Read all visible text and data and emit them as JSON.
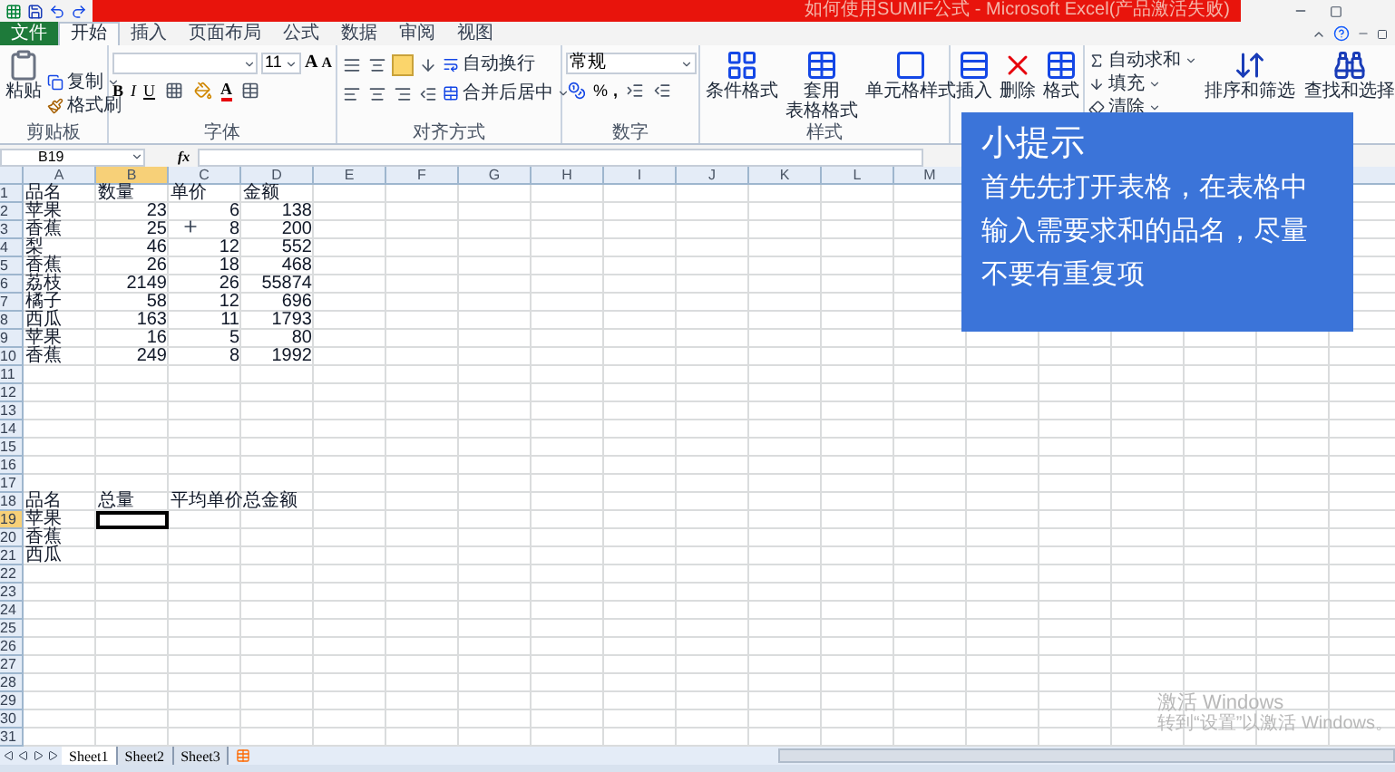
{
  "window": {
    "title": "如何使用SUMIF公式 - Microsoft Excel(产品激活失败)"
  },
  "ribbon_tabs": [
    {
      "label": "文件",
      "kind": "file",
      "selected": false
    },
    {
      "label": "开始",
      "kind": "tab",
      "selected": true
    },
    {
      "label": "插入",
      "kind": "tab",
      "selected": false
    },
    {
      "label": "页面布局",
      "kind": "tab",
      "selected": false
    },
    {
      "label": "公式",
      "kind": "tab",
      "selected": false
    },
    {
      "label": "数据",
      "kind": "tab",
      "selected": false
    },
    {
      "label": "审阅",
      "kind": "tab",
      "selected": false
    },
    {
      "label": "视图",
      "kind": "tab",
      "selected": false
    }
  ],
  "clipboard": {
    "label": "剪贴板",
    "paste": "粘贴",
    "copy": "复制",
    "format_painter": "格式刷"
  },
  "font": {
    "label": "字体",
    "size": "11",
    "grow": "A",
    "shrink": "A",
    "bold": "B",
    "italic": "I",
    "underline": "U",
    "font_color": "A"
  },
  "alignment": {
    "label": "对齐方式",
    "wrap": "自动换行",
    "merge": "合并后居中"
  },
  "number": {
    "label": "数字",
    "format": "常规",
    "percent": "%",
    "comma": ","
  },
  "styles": {
    "label": "样式",
    "items": [
      {
        "lines": [
          "条件格式"
        ]
      },
      {
        "lines": [
          "套用",
          "表格格式"
        ]
      },
      {
        "lines": [
          "单元格样式"
        ]
      }
    ]
  },
  "cells": {
    "items": [
      {
        "label": "插入"
      },
      {
        "label": "删除"
      },
      {
        "label": "格式"
      }
    ]
  },
  "editing": {
    "small": [
      {
        "label": "自动求和"
      },
      {
        "label": "填充"
      },
      {
        "label": "清除"
      }
    ],
    "large": [
      {
        "label": "排序和筛选"
      },
      {
        "label": "查找和选择"
      }
    ]
  },
  "formula_bar": {
    "name_box": "B19",
    "fx": "fx"
  },
  "sheet": {
    "columns": [
      {
        "letter": "A",
        "selected": false
      },
      {
        "letter": "B",
        "selected": true
      },
      {
        "letter": "C",
        "selected": false
      },
      {
        "letter": "D",
        "selected": false
      },
      {
        "letter": "E",
        "selected": false
      },
      {
        "letter": "F",
        "selected": false
      },
      {
        "letter": "G",
        "selected": false
      },
      {
        "letter": "H",
        "selected": false
      },
      {
        "letter": "I",
        "selected": false
      },
      {
        "letter": "J",
        "selected": false
      },
      {
        "letter": "K",
        "selected": false
      },
      {
        "letter": "L",
        "selected": false
      },
      {
        "letter": "M",
        "selected": false
      }
    ],
    "rows": [
      {
        "number": "1",
        "kind": "label",
        "selected": false,
        "cells": [
          "品名",
          "数量",
          "单价",
          "金额"
        ]
      },
      {
        "number": "2",
        "kind": "data",
        "selected": false,
        "cells": [
          "苹果",
          "23",
          "6",
          "138"
        ]
      },
      {
        "number": "3",
        "kind": "data",
        "selected": false,
        "cells": [
          "香蕉",
          "25",
          "8",
          "200"
        ]
      },
      {
        "number": "4",
        "kind": "data",
        "selected": false,
        "cells": [
          "梨",
          "46",
          "12",
          "552"
        ]
      },
      {
        "number": "5",
        "kind": "data",
        "selected": false,
        "cells": [
          "香蕉",
          "26",
          "18",
          "468"
        ]
      },
      {
        "number": "6",
        "kind": "data",
        "selected": false,
        "cells": [
          "荔枝",
          "2149",
          "26",
          "55874"
        ]
      },
      {
        "number": "7",
        "kind": "data",
        "selected": false,
        "cells": [
          "橘子",
          "58",
          "12",
          "696"
        ]
      },
      {
        "number": "8",
        "kind": "data",
        "selected": false,
        "cells": [
          "西瓜",
          "163",
          "11",
          "1793"
        ]
      },
      {
        "number": "9",
        "kind": "data",
        "selected": false,
        "cells": [
          "苹果",
          "16",
          "5",
          "80"
        ]
      },
      {
        "number": "10",
        "kind": "data",
        "selected": false,
        "cells": [
          "香蕉",
          "249",
          "8",
          "1992"
        ]
      },
      {
        "number": "11",
        "kind": "label",
        "selected": false,
        "cells": []
      },
      {
        "number": "12",
        "kind": "label",
        "selected": false,
        "cells": []
      },
      {
        "number": "13",
        "kind": "label",
        "selected": false,
        "cells": []
      },
      {
        "number": "14",
        "kind": "label",
        "selected": false,
        "cells": []
      },
      {
        "number": "15",
        "kind": "label",
        "selected": false,
        "cells": []
      },
      {
        "number": "16",
        "kind": "label",
        "selected": false,
        "cells": []
      },
      {
        "number": "17",
        "kind": "label",
        "selected": false,
        "cells": []
      },
      {
        "number": "18",
        "kind": "label",
        "selected": false,
        "cells": [
          "品名",
          "总量",
          "平均单价",
          "总金额"
        ]
      },
      {
        "number": "19",
        "kind": "label",
        "selected": true,
        "cells": [
          "苹果"
        ]
      },
      {
        "number": "20",
        "kind": "label",
        "selected": false,
        "cells": [
          "香蕉"
        ]
      },
      {
        "number": "21",
        "kind": "label",
        "selected": false,
        "cells": [
          "西瓜"
        ]
      },
      {
        "number": "22",
        "kind": "label",
        "selected": false,
        "cells": []
      },
      {
        "number": "23",
        "kind": "label",
        "selected": false,
        "cells": []
      },
      {
        "number": "24",
        "kind": "label",
        "selected": false,
        "cells": []
      },
      {
        "number": "25",
        "kind": "label",
        "selected": false,
        "cells": []
      },
      {
        "number": "26",
        "kind": "label",
        "selected": false,
        "cells": []
      },
      {
        "number": "27",
        "kind": "label",
        "selected": false,
        "cells": []
      },
      {
        "number": "28",
        "kind": "label",
        "selected": false,
        "cells": []
      },
      {
        "number": "29",
        "kind": "label",
        "selected": false,
        "cells": []
      },
      {
        "number": "30",
        "kind": "label",
        "selected": false,
        "cells": []
      },
      {
        "number": "31",
        "kind": "label",
        "selected": false,
        "cells": []
      }
    ]
  },
  "sheet_tabs": [
    {
      "label": "Sheet1",
      "selected": true
    },
    {
      "label": "Sheet2",
      "selected": false
    },
    {
      "label": "Sheet3",
      "selected": false
    }
  ],
  "tip": {
    "title": "小提示",
    "body": "首先先打开表格，在表格中输入需要求和的品名，尽量不要有重复项"
  },
  "activation": {
    "title": "激活 Windows",
    "subtitle": "转到“设置”以激活 Windows。"
  }
}
